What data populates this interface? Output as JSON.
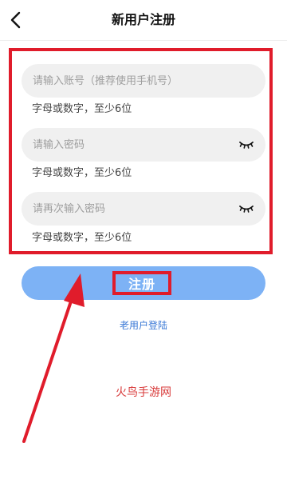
{
  "header": {
    "title": "新用户注册",
    "back_icon": "chevron-left-icon"
  },
  "form": {
    "account": {
      "placeholder": "请输入账号（推荐使用手机号）",
      "hint": "字母或数字，至少6位"
    },
    "password": {
      "placeholder": "请输入密码",
      "hint": "字母或数字，至少6位",
      "icon": "eye-closed-icon"
    },
    "confirm_password": {
      "placeholder": "请再次输入密码",
      "hint": "字母或数字，至少6位",
      "icon": "eye-closed-icon"
    }
  },
  "register_button": {
    "label": "注册"
  },
  "login_link": "老用户登陆",
  "watermark": "火鸟手游网",
  "colors": {
    "button": "#7db2f5",
    "link": "#3a78d6",
    "annotation": "#e01c2b",
    "watermark": "#d83a3a"
  }
}
